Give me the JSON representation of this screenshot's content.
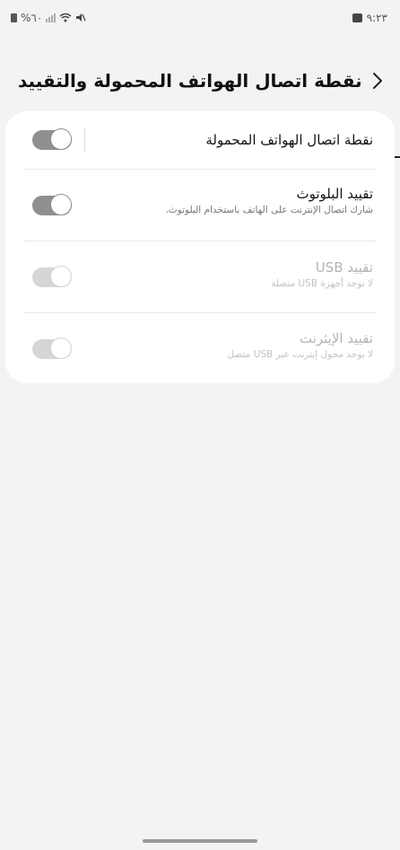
{
  "status_bar": {
    "battery_text": "%٦٠",
    "time": "٩:٢٣"
  },
  "header": {
    "title": "نقطة اتصال الهواتف المحمولة والتقييد"
  },
  "settings": {
    "hotspot": {
      "title": "نقطة اتصال الهواتف المحمولة",
      "enabled": false
    },
    "bluetooth_tethering": {
      "title": "تقييد البلوتوث",
      "subtitle": "شارك اتصال الإنترنت على الهاتف باستخدام البلوتوث.",
      "enabled": false
    },
    "usb_tethering": {
      "title": "تقييد USB",
      "subtitle": "لا توجد أجهزة USB متصلة",
      "enabled": false,
      "disabled": true
    },
    "ethernet_tethering": {
      "title": "تقييد الإيثرنت",
      "subtitle": "لا يوجد محول إيثرنت عبر USB متصل",
      "enabled": false,
      "disabled": true
    }
  }
}
